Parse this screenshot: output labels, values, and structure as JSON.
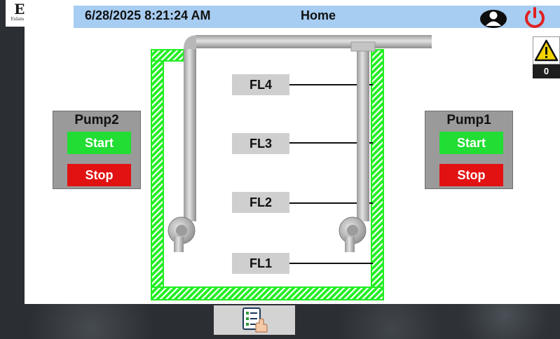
{
  "header": {
    "logo_letters": "ES",
    "logo_name": "Eslam Sayed",
    "datetime": "6/28/2025 8:21:24 AM",
    "title": "Home",
    "user_icon": "user-account-icon",
    "power_icon": "power-icon"
  },
  "alarm": {
    "icon": "warning-triangle-icon",
    "count": "0"
  },
  "pumps": [
    {
      "title": "Pump2",
      "start_label": "Start",
      "stop_label": "Stop"
    },
    {
      "title": "Pump1",
      "start_label": "Start",
      "stop_label": "Stop"
    }
  ],
  "levels": [
    "FL4",
    "FL3",
    "FL2",
    "FL1"
  ],
  "bottom_nav": {
    "icon": "checklist-hand-icon"
  },
  "colors": {
    "header_bg": "#a7cdf2",
    "tank_border": "#22ee22",
    "start_button": "#22dd33",
    "stop_button": "#e21212",
    "power_icon": "#e02020",
    "warning_icon": "#f2d300"
  }
}
